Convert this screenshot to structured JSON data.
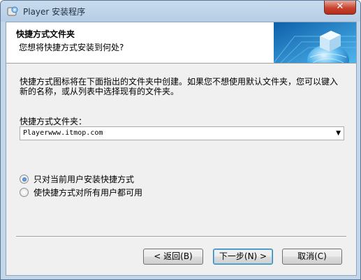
{
  "window": {
    "title": "Player 安装程序",
    "close_label": "✕"
  },
  "header": {
    "title": "快捷方式文件夹",
    "subtitle": "您想将快捷方式安装到何处?"
  },
  "content": {
    "description": "快捷方式图标将在下面指出的文件夹中创建。如果您不想使用默认文件夹，您可以键入新的名称，或从列表中选择现有的文件夹。",
    "folder_label": "快捷方式文件夹：",
    "folder_value": "Playerwww.itmop.com",
    "radio_options": [
      {
        "label": "只对当前用户安装快捷方式",
        "selected": true
      },
      {
        "label": "使快捷方式对所有用户都可用",
        "selected": false
      }
    ]
  },
  "buttons": {
    "back": "< 返回(B)",
    "next": "下一步(N) >",
    "cancel": "取消(C)"
  },
  "colors": {
    "window_frame": "#c3d7ea",
    "close_button": "#c7432f",
    "header_graphic": "#2f8fd6"
  }
}
